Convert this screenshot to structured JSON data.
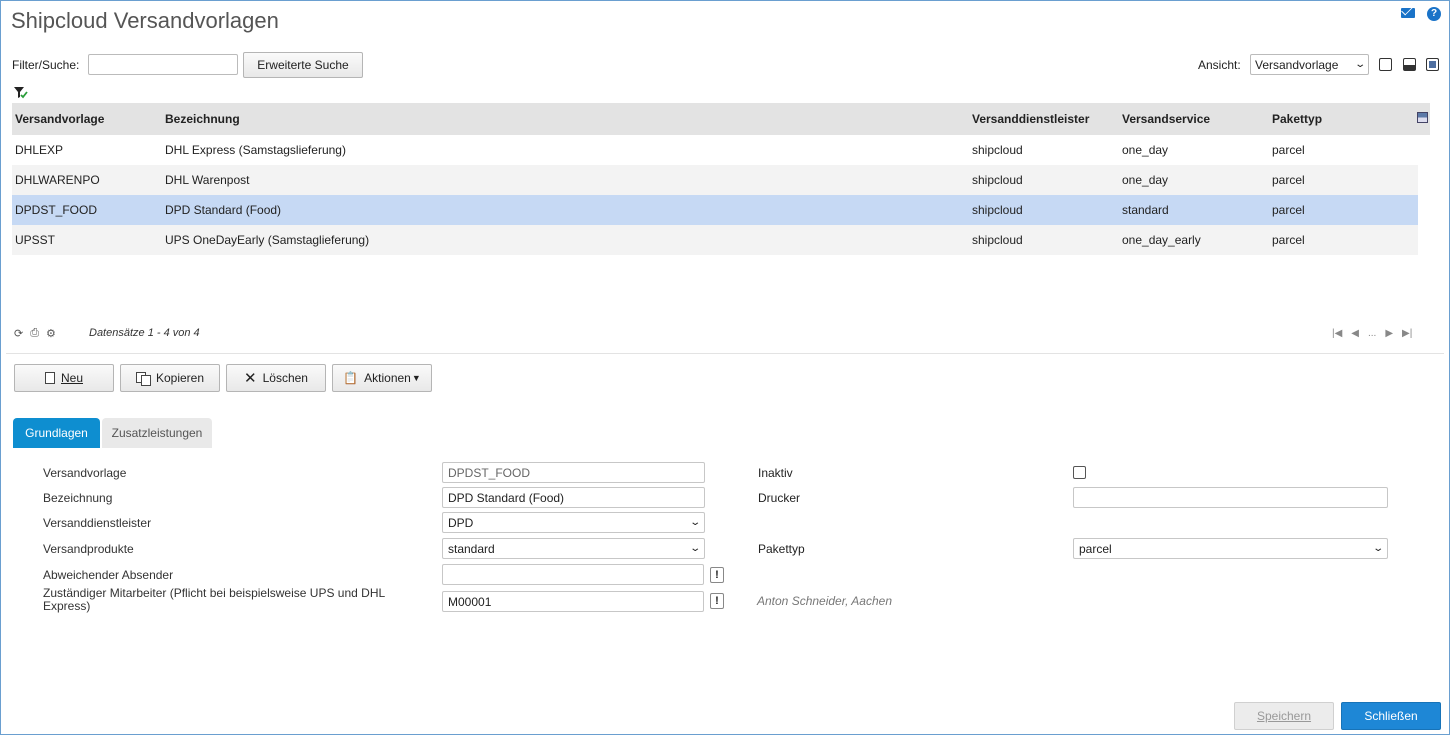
{
  "header": {
    "title": "Shipcloud Versandvorlagen"
  },
  "filter": {
    "label": "Filter/Suche:",
    "value": "",
    "extended_button": "Erweiterte Suche"
  },
  "view": {
    "label": "Ansicht:",
    "selected": "Versandvorlage"
  },
  "grid": {
    "columns": [
      "Versandvorlage",
      "Bezeichnung",
      "Versanddienstleister",
      "Versandservice",
      "Pakettyp"
    ],
    "rows": [
      [
        "DHLEXP",
        "DHL Express (Samstagslieferung)",
        "shipcloud",
        "one_day",
        "parcel"
      ],
      [
        "DHLWARENPO",
        "DHL Warenpost",
        "shipcloud",
        "one_day",
        "parcel"
      ],
      [
        "DPDST_FOOD",
        "DPD Standard (Food)",
        "shipcloud",
        "standard",
        "parcel"
      ],
      [
        "UPSST",
        "UPS OneDayEarly (Samstaglieferung)",
        "shipcloud",
        "one_day_early",
        "parcel"
      ]
    ],
    "selected_row": 2,
    "records": "Datensätze 1 - 4 von 4",
    "pager_ellipsis": "..."
  },
  "actions": {
    "new": "Neu",
    "copy": "Kopieren",
    "delete": "Löschen",
    "actions": "Aktionen"
  },
  "tabs": {
    "basics": "Grundlagen",
    "extras": "Zusatzleistungen"
  },
  "form": {
    "versandvorlage": {
      "label": "Versandvorlage",
      "value": "DPDST_FOOD"
    },
    "bezeichnung": {
      "label": "Bezeichnung",
      "value": "DPD Standard (Food)"
    },
    "dienstleister": {
      "label": "Versanddienstleister",
      "value": "DPD"
    },
    "produkte": {
      "label": "Versandprodukte",
      "value": "standard"
    },
    "absender": {
      "label": "Abweichender Absender",
      "value": ""
    },
    "mitarbeiter": {
      "label": "Zuständiger Mitarbeiter (Pflicht bei beispielsweise UPS und DHL Express)",
      "value": "M00001",
      "hint": "Anton Schneider, Aachen"
    },
    "inaktiv": {
      "label": "Inaktiv",
      "checked": false
    },
    "drucker": {
      "label": "Drucker",
      "value": ""
    },
    "pakettyp": {
      "label": "Pakettyp",
      "value": "parcel"
    }
  },
  "footer": {
    "save": "Speichern",
    "close": "Schließen"
  },
  "colors": {
    "accent": "#0e8ed0",
    "selected_row": "#c6d9f4",
    "close_button": "#1e87d6"
  }
}
